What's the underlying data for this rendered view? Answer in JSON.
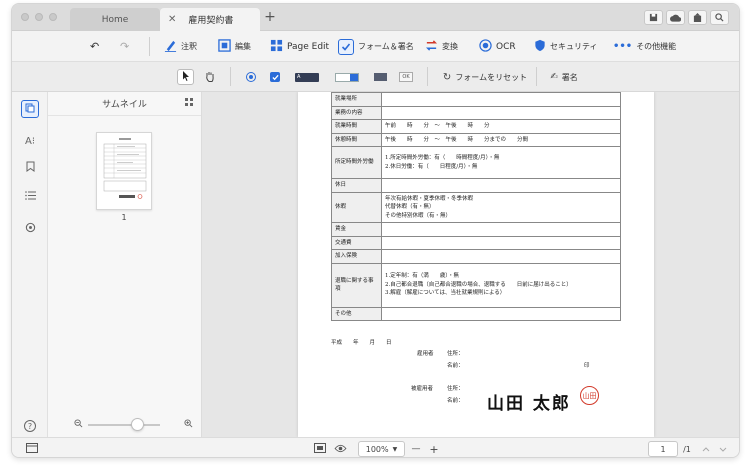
{
  "window": {
    "tabs": [
      {
        "label": "Home"
      },
      {
        "label": "雇用契約書",
        "close_glyph": "✕"
      }
    ],
    "new_tab_glyph": "+"
  },
  "toolbar": {
    "undo_glyph": "↶",
    "redo_glyph": "↷",
    "items": [
      {
        "label": "注釈",
        "icon": "pen-icon"
      },
      {
        "label": "編集",
        "icon": "edit-icon"
      },
      {
        "label": "Page Edit",
        "icon": "page-grid-icon"
      },
      {
        "label": "フォーム＆署名",
        "icon": "form-checkbox-icon"
      },
      {
        "label": "変換",
        "icon": "convert-icon"
      },
      {
        "label": "OCR",
        "icon": "ocr-icon"
      },
      {
        "label": "セキュリティ",
        "icon": "shield-icon"
      },
      {
        "label": "その他機能",
        "icon": "more-icon"
      }
    ]
  },
  "formbar": {
    "reset_label": "フォームをリセット",
    "sign_label": "署名",
    "ok_label": "OK"
  },
  "thumbnails": {
    "title": "サムネイル",
    "page_number": "1"
  },
  "document": {
    "rows": [
      {
        "label": "就業場所",
        "value": ""
      },
      {
        "label": "業務の内容",
        "value": ""
      },
      {
        "label": "就業時間",
        "value": "午前　　時　　分　～　午後　　時　　分"
      },
      {
        "label": "休憩時間",
        "value": "午後　　時　　分　～　午後　　時　　分までの　　分間"
      },
      {
        "label": "所定時間外労働",
        "value": "1.所定時間外労働：有（　　時間程度/月）・無\n2.休日労働：有（　　日程度/月）・無"
      },
      {
        "label": "休日",
        "value": ""
      },
      {
        "label": "休暇",
        "value": "年次有給休暇・夏季休暇・冬季休暇\n代替休暇（有・無）\nその他特別休暇（有・無）"
      },
      {
        "label": "賃金",
        "value": ""
      },
      {
        "label": "交通費",
        "value": ""
      },
      {
        "label": "加入保険",
        "value": ""
      },
      {
        "label": "退職に関する事項",
        "value": "1.定年制：有（満　　歳）・無\n2.自己都合退職（自己都合退職の場合、退職する　　日前に届け出ること）\n3.解雇（解雇については、当社就業規則による）"
      },
      {
        "label": "その他",
        "value": ""
      }
    ],
    "date_line": "平成　　年　　月　　日",
    "employer_label": "雇用者",
    "employee_label": "被雇用者",
    "address_label": "住所：",
    "name_label": "名前：",
    "seal_label": "印",
    "signature_name": "山田 太郎",
    "stamp_text": "山田"
  },
  "statusbar": {
    "zoom_value": "100%",
    "zoom_out": "—",
    "zoom_in": "+",
    "current_page": "1",
    "total_pages": "/1"
  },
  "colors": {
    "accent": "#2b6cd8",
    "stamp_red": "#d23a2a"
  }
}
